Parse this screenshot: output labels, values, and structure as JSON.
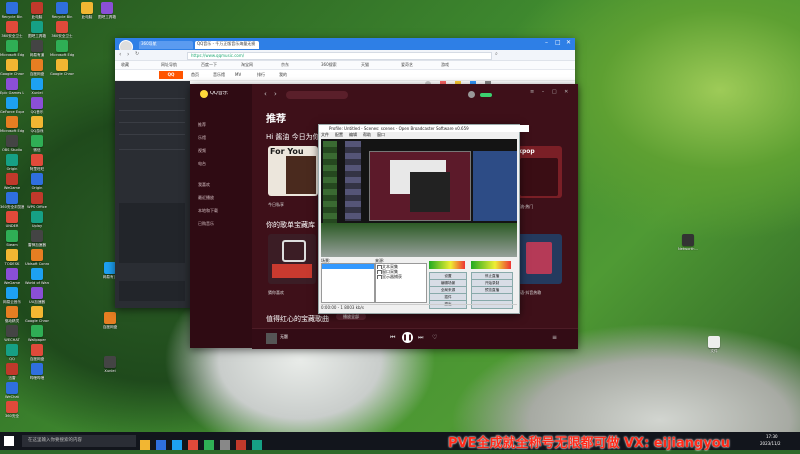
{
  "desktop": {
    "icons_col1": [
      "Recycle Bin",
      "360安全卫士",
      "Microsoft Edge",
      "Google Chrome",
      "Epic Games Launcher",
      "GeForce Experience",
      "Microsoft Edge",
      "OBS Studio",
      "Origin",
      "WeGame",
      "360安全浏览器",
      "UNDER",
      "Steam",
      "TODESK",
      "WeGame",
      "网易云音乐",
      "驱动精灵",
      "WECHAT",
      "QQ",
      "迅雷",
      "WeChat",
      "360安全"
    ],
    "icons_col2": [
      "此电脑",
      "图吧工具箱",
      "网易有道",
      "百度网盘",
      "Xunlei",
      "QQ音乐",
      "QQ游戏",
      "微信",
      "阿里旺旺",
      "Origin",
      "WPS Office",
      "Uplay",
      "雷神加速器",
      "Ubisoft Connect",
      "World of Warcraft",
      "UU加速器",
      "Google Chrome",
      "Wallpaper",
      "百度网盘",
      "哔哩哔哩"
    ],
    "right_icons": [
      "Networth...",
      "文件"
    ]
  },
  "browser": {
    "tabs": [
      {
        "label": "360导航"
      },
      {
        "label": "QQ音乐 - 千万正版音乐海量无损"
      }
    ],
    "address": "https://www.qqmusic.com/",
    "bookmarks": [
      "收藏",
      "网址导航",
      "百度一下",
      "淘宝网",
      "京东",
      "360搜索",
      "天猫",
      "爱奇艺",
      "游戏"
    ],
    "nav_links": [
      "首页",
      "音乐馆",
      "MV",
      "排行",
      "我的"
    ]
  },
  "qqmusic": {
    "logo": "QQ音乐",
    "section_title": "推荐",
    "greeting": "Hi 酱油 今日为你推荐",
    "card1_label": "For You",
    "card1_caption": "今日私享",
    "radar_title": "你的歌单宝藏库",
    "radar_caption": "猜你喜欢",
    "kpop_caption": "韩流·热门",
    "card_r2_caption": "华语·抖音热歌",
    "red_heart_title": "值得红心的宝藏歌曲",
    "play_all": "播放全部",
    "now_playing": "无题",
    "sidebar_items": [
      "推荐",
      "乐馆",
      "视频",
      "电台",
      "我喜欢",
      "最近播放",
      "本地和下载",
      "已购音乐"
    ]
  },
  "obs": {
    "title": "Profile: Untitled - Scenes: scenes - Open Broadcaster Software v0.659",
    "menu": [
      "文件",
      "配置",
      "编辑",
      "帮助",
      "窗口"
    ],
    "scenes_label": "场景:",
    "sources_label": "来源:",
    "sources": [
      "文本采集",
      "窗口采集",
      "显示器捕获"
    ],
    "buttons_left": [
      "设置",
      "编辑场景",
      "全局来源",
      "插件",
      "退出"
    ],
    "buttons_right": [
      "停止直播",
      "开始录制",
      "预览直播",
      "",
      ""
    ],
    "status": "0:00:00 - 1 8003 kb/s"
  },
  "taskbar": {
    "search_placeholder": "在这里输入你要搜索的内容",
    "time": "17:30",
    "date": "2023/11/2"
  },
  "watermark": "PVE全成就全称号无限都可做 VX: eijiangyou"
}
